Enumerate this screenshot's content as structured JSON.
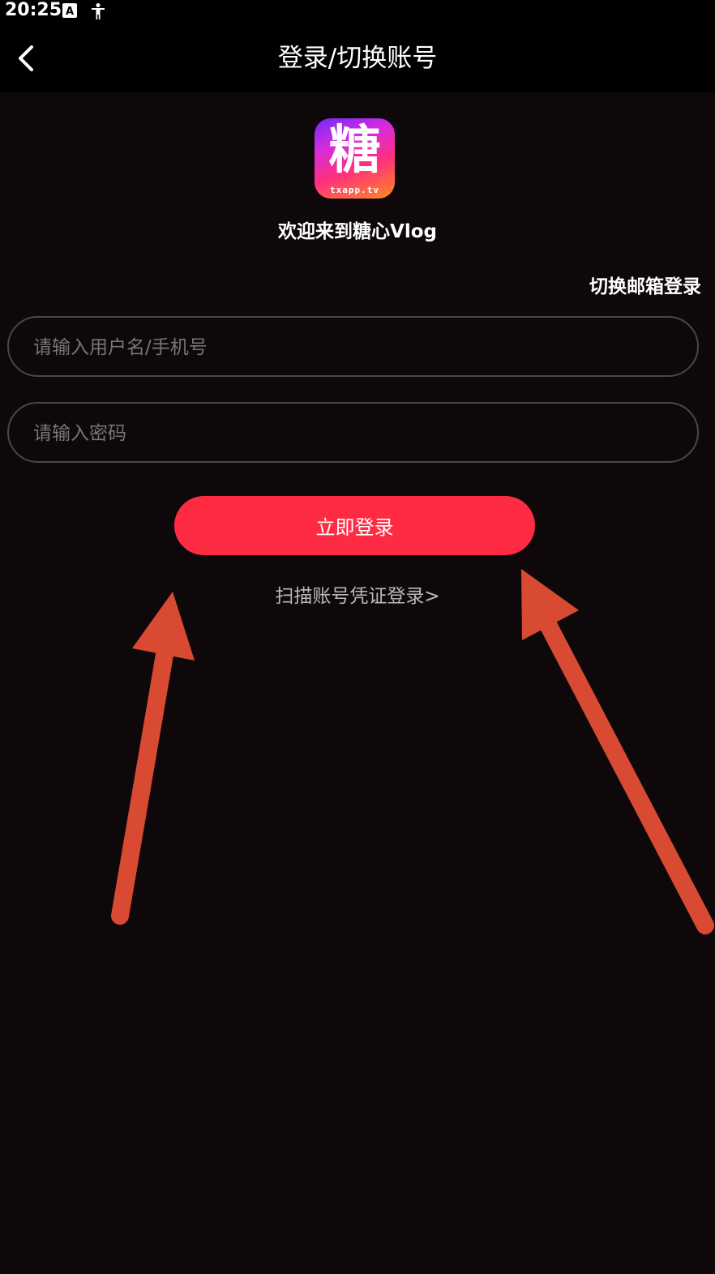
{
  "status_bar": {
    "time": "20:25",
    "icons": [
      "translate-icon",
      "accessibility-icon"
    ]
  },
  "header": {
    "title": "登录/切换账号",
    "back_icon": "chevron-left-icon"
  },
  "logo": {
    "glyph": "糖",
    "caption": "txapp.tv"
  },
  "welcome_text": "欢迎来到糖心Vlog",
  "switch_login_link": "切换邮箱登录",
  "form": {
    "username_placeholder": "请输入用户名/手机号",
    "username_value": "",
    "password_placeholder": "请输入密码",
    "password_value": ""
  },
  "login_button": "立即登录",
  "scan_link": "扫描账号凭证登录>",
  "colors": {
    "background": "#0f080b",
    "header": "#000000",
    "primary_button": "#ff2b43",
    "annotation_arrow": "#d94a32"
  }
}
